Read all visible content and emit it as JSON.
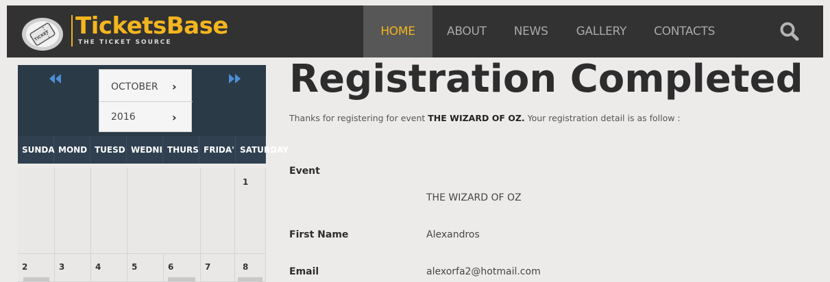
{
  "brand": {
    "name": "TicketsBase",
    "tagline": "THE TICKET SOURCE",
    "badge_text": "TICKET",
    "accent": "#f4b51f"
  },
  "nav": {
    "items": [
      {
        "label": "HOME",
        "active": true
      },
      {
        "label": "ABOUT",
        "active": false
      },
      {
        "label": "NEWS",
        "active": false
      },
      {
        "label": "GALLERY",
        "active": false
      },
      {
        "label": "CONTACTS",
        "active": false
      }
    ],
    "search_icon": "search-icon"
  },
  "calendar": {
    "month": "OCTOBER",
    "year": "2016",
    "prev_icon": "double-chevron-left-icon",
    "next_icon": "double-chevron-right-icon",
    "weekdays": [
      "SUNDA",
      "MOND",
      "TUESD",
      "WEDNI",
      "THURS",
      "FRIDA'",
      "SATURDAY"
    ],
    "row1": [
      "",
      "",
      "",
      "",
      "",
      "",
      "1"
    ],
    "row2": [
      "2",
      "3",
      "4",
      "5",
      "6",
      "7",
      "8"
    ]
  },
  "main": {
    "title": "Registration Completed",
    "intro_prefix": "Thanks for registering for event ",
    "intro_event": "THE WIZARD OF OZ.",
    "intro_suffix": " Your registration detail is as follow :",
    "fields": [
      {
        "label": "Event",
        "value": "THE WIZARD OF OZ"
      },
      {
        "label": "First Name",
        "value": "Alexandros"
      },
      {
        "label": "Email",
        "value": "alexorfa2@hotmail.com"
      }
    ]
  }
}
